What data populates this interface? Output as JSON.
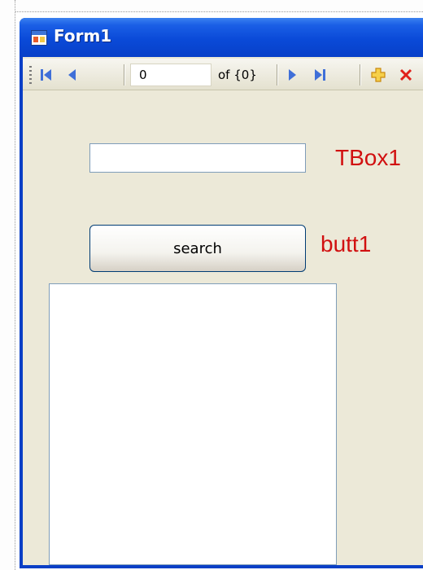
{
  "window": {
    "title": "Form1"
  },
  "toolbar": {
    "position_value": "0",
    "count_label": "of {0}",
    "icons": [
      "move-first-icon",
      "move-previous-icon",
      "move-next-icon",
      "move-last-icon",
      "add-new-icon",
      "delete-icon"
    ]
  },
  "form": {
    "textbox_value": "",
    "textbox_caption": "TBox1",
    "search_button_label": "search",
    "button_caption": "butt1"
  },
  "colors": {
    "titlebar": "#0a4ad8",
    "client_background": "#ece9d8",
    "caption_red": "#d11010",
    "nav_icon_blue": "#3f6fd8",
    "add_icon": "#f0b020",
    "delete_icon": "#e0201a"
  }
}
